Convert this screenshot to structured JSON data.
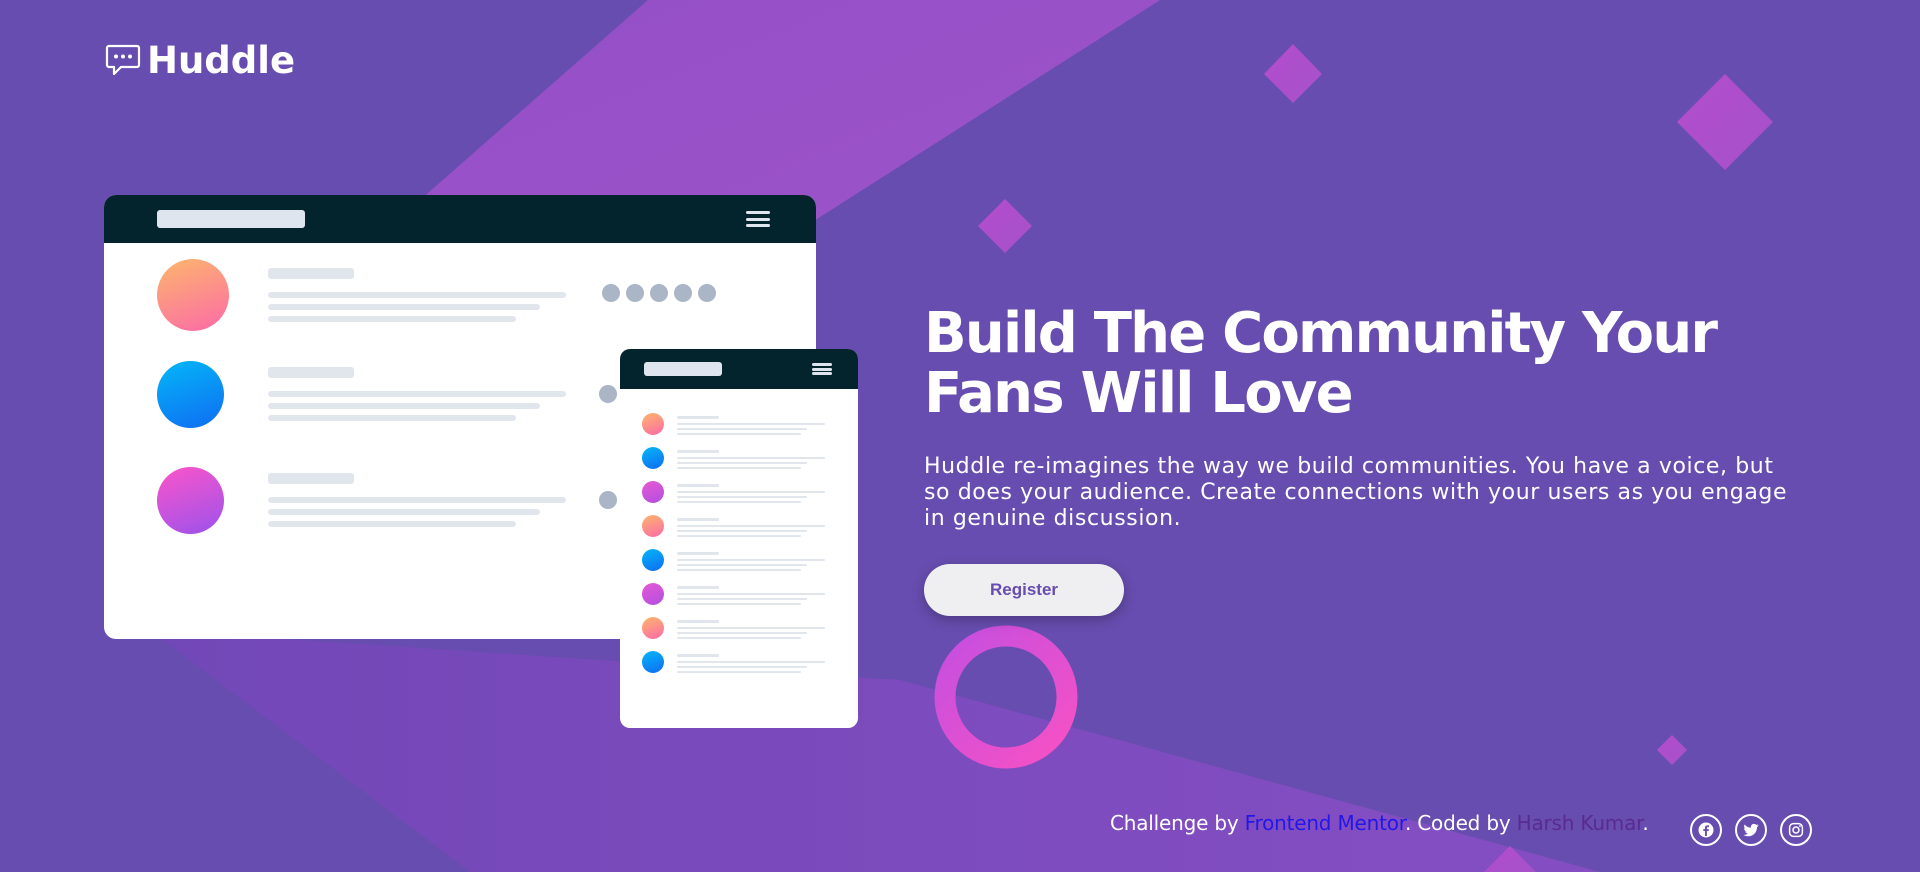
{
  "brand": {
    "name": "Huddle",
    "logo_icon": "chat-bubble-icon"
  },
  "mockup": {
    "desktop_avatar_colors": [
      [
        "#fdb66c",
        "#fb6aa7"
      ],
      [
        "#04b7f8",
        "#0f6cf2"
      ],
      [
        "#fb55c9",
        "#9c52ec"
      ]
    ],
    "mobile_avatar_colors": [
      [
        "#fdb66c",
        "#fb6aa7"
      ],
      [
        "#04b7f8",
        "#0f6cf2"
      ],
      [
        "#e55ad4",
        "#b34ee0"
      ],
      [
        "#fdb66c",
        "#fb6aa7"
      ],
      [
        "#04b7f8",
        "#0f6cf2"
      ],
      [
        "#e55ad4",
        "#b34ee0"
      ],
      [
        "#fdb66c",
        "#fb6aa7"
      ],
      [
        "#04b7f8",
        "#0f6cf2"
      ]
    ]
  },
  "hero": {
    "title_line1": "Build The Community Your",
    "title_line2": "Fans Will Love",
    "description": "Huddle re-imagines the way we build communities. You have a voice, but so does your audience. Create connections with your users as you engage in genuine discussion.",
    "cta_label": "Register"
  },
  "footer": {
    "challenge_prefix": "Challenge by ",
    "challenge_link": "Frontend Mentor",
    "coded_prefix": ". Coded by ",
    "author_link": "Harsh Kumar",
    "suffix": ".",
    "socials": [
      "facebook-icon",
      "twitter-icon",
      "instagram-icon"
    ]
  },
  "colors": {
    "background": "#674daf",
    "mockup_bar": "#03242d",
    "cta_text": "#674daf",
    "link_frontend_mentor": "#2317e8",
    "link_author": "#5a2b8f"
  }
}
